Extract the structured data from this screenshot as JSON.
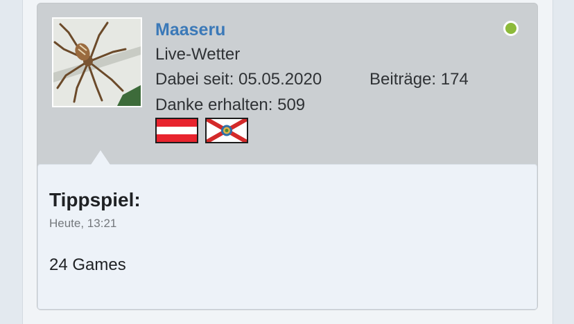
{
  "user": {
    "name": "Maaseru",
    "title": "Live-Wetter",
    "joined": "Dabei seit: 05.05.2020",
    "posts": "Beiträge: 174",
    "thanks": "Danke erhalten: 509",
    "online_color": "#8dba3a",
    "name_color": "#3b79b8"
  },
  "message": {
    "title": "Tippspiel:",
    "time": "Heute, 13:21",
    "body": "24 Games"
  }
}
